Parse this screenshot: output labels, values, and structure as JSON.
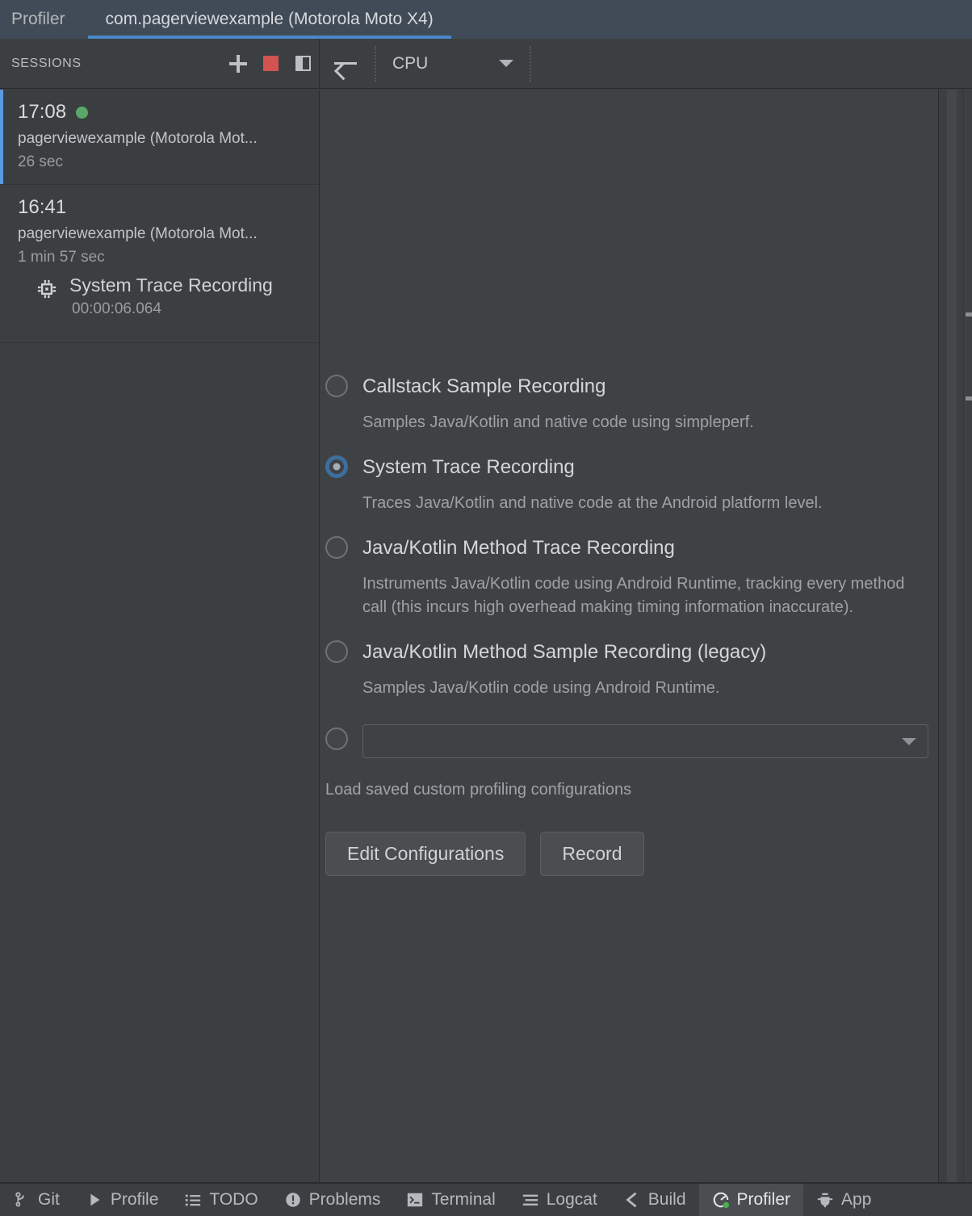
{
  "window": {
    "tabs": [
      {
        "label": "Profiler",
        "active": false
      },
      {
        "label": "com.pagerviewexample (Motorola Moto X4)",
        "active": true
      }
    ],
    "accent_color": "#4a88c7"
  },
  "toolbar": {
    "sessions_label": "SESSIONS",
    "add_session_icon": "plus-icon",
    "stop_icon": "stop-square-icon",
    "split_icon": "split-panel-icon",
    "back_icon": "back-arrow-icon",
    "stage_select": {
      "value": "CPU",
      "caret_icon": "chevron-down-icon"
    }
  },
  "sessions": [
    {
      "time": "17:08",
      "live": true,
      "name": "pagerviewexample (Motorola Mot...",
      "duration": "26 sec",
      "selected": true,
      "artifacts": []
    },
    {
      "time": "16:41",
      "live": false,
      "name": "pagerviewexample (Motorola Mot...",
      "duration": "1 min 57 sec",
      "selected": false,
      "artifacts": [
        {
          "icon": "cpu-chip-icon",
          "title": "System Trace Recording",
          "timestamp": "00:00:06.064"
        }
      ]
    }
  ],
  "recording_config": {
    "options": [
      {
        "title": "Callstack Sample Recording",
        "description": "Samples Java/Kotlin and native code using simpleperf.",
        "selected": false
      },
      {
        "title": "System Trace Recording",
        "description": "Traces Java/Kotlin and native code at the Android platform level.",
        "selected": true
      },
      {
        "title": "Java/Kotlin Method Trace Recording",
        "description": "Instruments Java/Kotlin code using Android Runtime, tracking every method call (this incurs high overhead making timing information inaccurate).",
        "selected": false
      },
      {
        "title": "Java/Kotlin Method Sample Recording (legacy)",
        "description": "Samples Java/Kotlin code using Android Runtime.",
        "selected": false
      }
    ],
    "custom": {
      "selected": false,
      "value": "",
      "placeholder": "",
      "caret_icon": "chevron-down-icon",
      "note": "Load saved custom profiling configurations"
    },
    "buttons": {
      "edit": "Edit Configurations",
      "record": "Record"
    }
  },
  "status_bar": {
    "items": [
      {
        "label": "Git",
        "icon": "git-branch-icon",
        "active": false
      },
      {
        "label": "Profile",
        "icon": "play-triangle-icon",
        "active": false
      },
      {
        "label": "TODO",
        "icon": "list-icon",
        "active": false
      },
      {
        "label": "Problems",
        "icon": "warning-circle-icon",
        "active": false
      },
      {
        "label": "Terminal",
        "icon": "terminal-icon",
        "active": false
      },
      {
        "label": "Logcat",
        "icon": "logcat-lines-icon",
        "active": false
      },
      {
        "label": "Build",
        "icon": "hammer-icon",
        "active": false
      },
      {
        "label": "Profiler",
        "icon": "profiler-gauge-icon",
        "active": true
      },
      {
        "label": "App",
        "icon": "app-inspection-icon",
        "active": false
      }
    ]
  }
}
